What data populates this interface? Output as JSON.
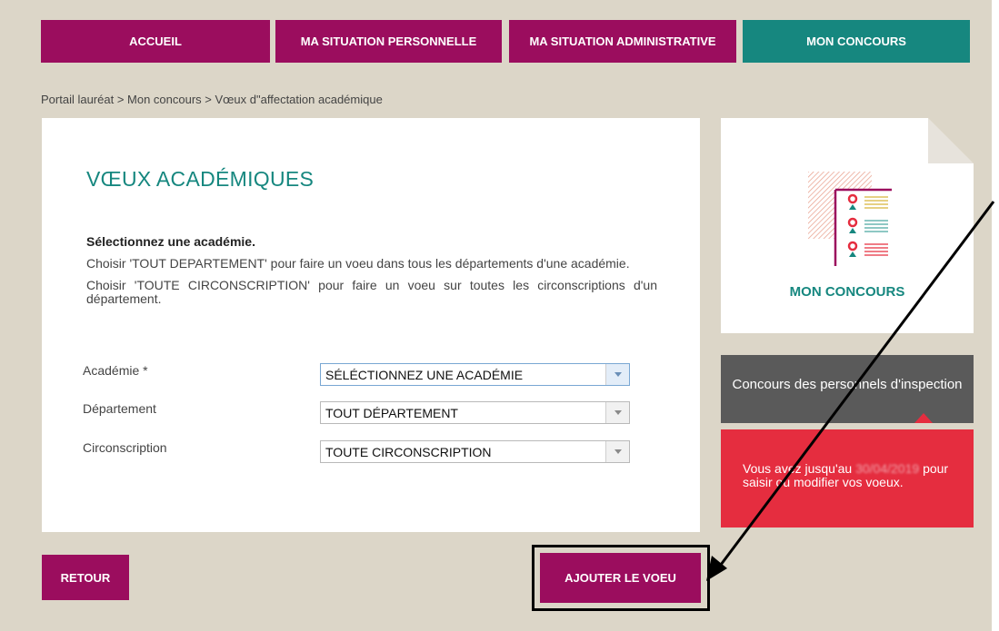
{
  "nav": {
    "accueil": "ACCUEIL",
    "situation_personnelle": "MA SITUATION PERSONNELLE",
    "situation_administrative": "MA SITUATION ADMINISTRATIVE",
    "mon_concours": "MON CONCOURS"
  },
  "breadcrumb": "Portail lauréat > Mon concours > Vœux d\"affectation académique",
  "main": {
    "title": "VŒUX ACADÉMIQUES",
    "instruction_bold": "Sélectionnez une académie.",
    "instruction_1": "Choisir 'TOUT DEPARTEMENT' pour faire un voeu dans tous les départements d'une académie.",
    "instruction_2": "Choisir 'TOUTE CIRCONSCRIPTION' pour faire un voeu sur toutes les circonscriptions d'un département."
  },
  "form": {
    "academie_label": "Académie *",
    "academie_value": "SÉLÉCTIONNEZ UNE ACADÉMIE",
    "departement_label": "Département",
    "departement_value": "TOUT DÉPARTEMENT",
    "circonscription_label": "Circonscription",
    "circonscription_value": "TOUTE CIRCONSCRIPTION"
  },
  "sidebar": {
    "card_title": "MON CONCOURS",
    "card_icon": "concours-list-icon",
    "concours_name": "Concours des personnels d'inspection",
    "deadline_prefix": "Vous avez jusqu'au",
    "deadline_date_redacted": "30/04/2019",
    "deadline_suffix": "pour saisir ou modifier vos voeux."
  },
  "buttons": {
    "retour": "RETOUR",
    "ajouter": "AJOUTER LE VOEU"
  },
  "colors": {
    "primary": "#9b0d5e",
    "accent": "#16877f",
    "background": "#dcd6c8",
    "alert": "#e52d3f",
    "dark_box": "#5a5a5a"
  }
}
